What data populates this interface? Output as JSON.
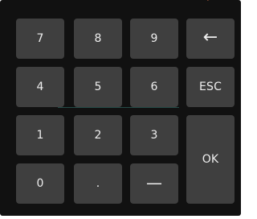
{
  "keypad": {
    "keys": {
      "k7": "7",
      "k8": "8",
      "k9": "9",
      "backspace": "←",
      "k4": "4",
      "k5": "5",
      "k6": "6",
      "esc": "ESC",
      "k1": "1",
      "k2": "2",
      "k3": "3",
      "ok": "OK",
      "k0": "0",
      "dot": ".",
      "minus": "—"
    },
    "colors": {
      "background": "#111111",
      "key_background": "#3f3f3f",
      "key_text": "#eeeeee"
    }
  }
}
